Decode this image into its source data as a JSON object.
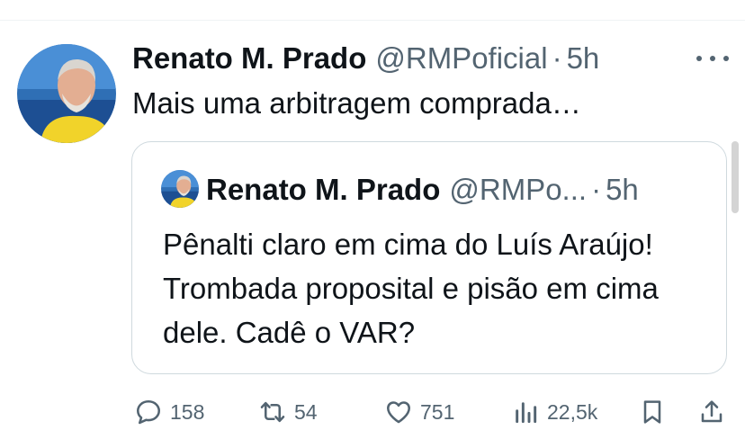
{
  "tweet": {
    "author_name": "Renato M. Prado",
    "author_handle": "@RMPoficial",
    "separator": "·",
    "time": "5h",
    "text": "Mais uma arbitragem comprada…"
  },
  "quoted_tweet": {
    "author_name": "Renato M. Prado",
    "author_handle": "@RMPo...",
    "separator": "·",
    "time": "5h",
    "text": "Pênalti claro em cima do Luís Araújo! Trombada proposital e pisão em cima dele. Cadê o VAR?"
  },
  "actions": {
    "replies": "158",
    "reposts": "54",
    "likes": "751",
    "views": "22,5k"
  },
  "icons": {
    "more": "more-dots-icon",
    "reply": "reply-icon",
    "repost": "repost-icon",
    "like": "heart-icon",
    "views": "views-chart-icon",
    "bookmark": "bookmark-icon",
    "share": "share-icon"
  },
  "colors": {
    "text": "#0f1419",
    "secondary": "#536471",
    "border": "#cfd9de"
  }
}
